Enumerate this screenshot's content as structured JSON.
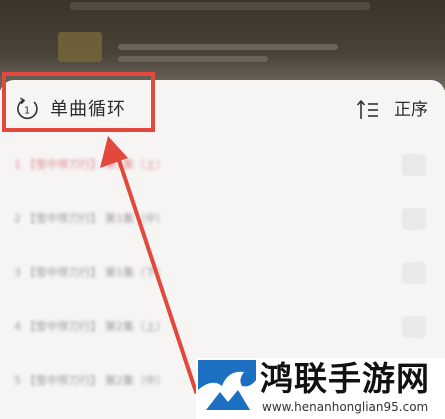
{
  "header": {
    "loop_icon": "repeat-one-icon",
    "loop_icon_digit": "1",
    "play_mode_label": "单曲循环",
    "sort_icon": "sort-order-icon",
    "sort_label": "正序"
  },
  "playlist": {
    "items": [
      {
        "text": "1 【雪中悍刀行】 第1集（上）",
        "active": true
      },
      {
        "text": "2 【雪中悍刀行】 第1集（中）",
        "active": false
      },
      {
        "text": "3 【雪中悍刀行】 第1集（下）",
        "active": false
      },
      {
        "text": "4 【雪中悍刀行】 第2集（上）",
        "active": false
      },
      {
        "text": "5 【雪中悍刀行】 第2集（中）",
        "active": false
      }
    ]
  },
  "watermark": {
    "brand": "鸿联手游网",
    "domain": "www.henanhonglian95.com"
  },
  "colors": {
    "highlight": "#e3483c",
    "active_text": "#e58b93",
    "logo_blue": "#1d6fc2"
  }
}
